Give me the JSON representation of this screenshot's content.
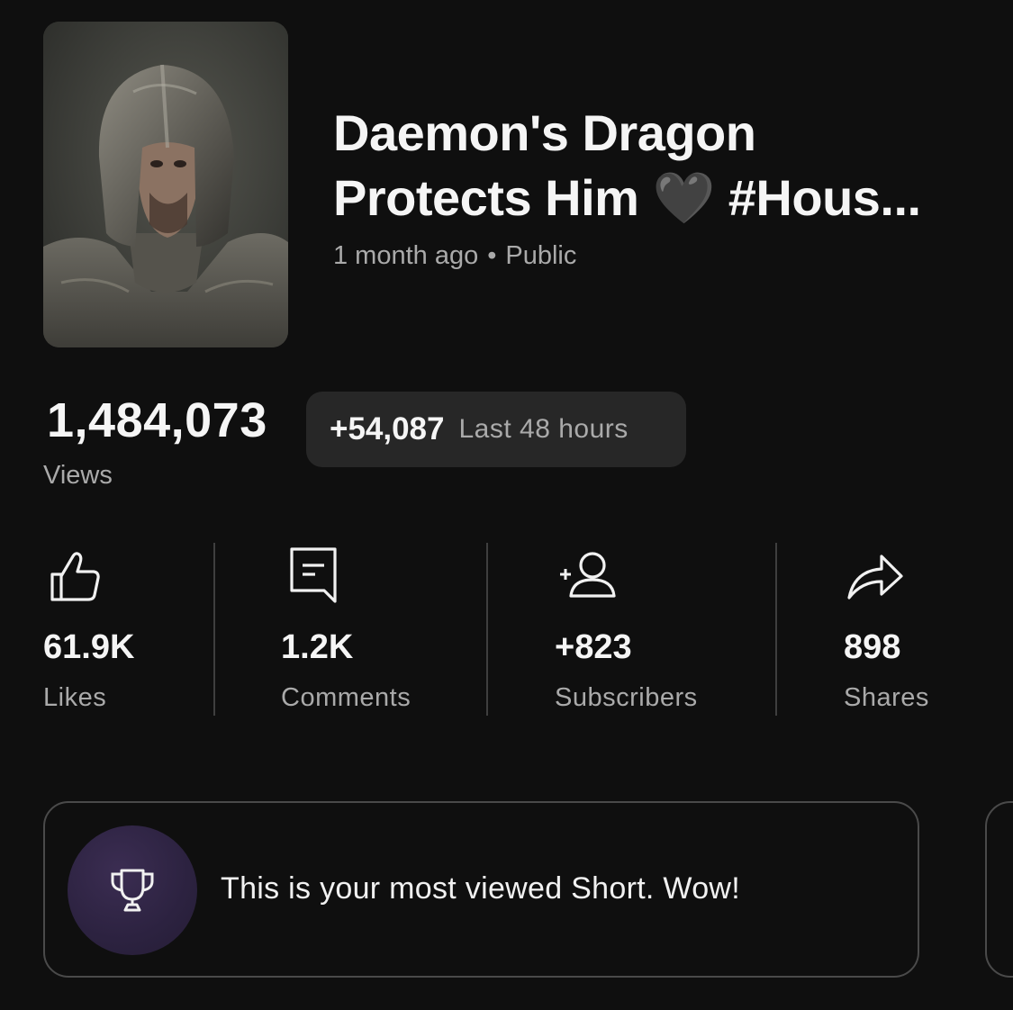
{
  "video": {
    "title": "Daemon's Dragon\nProtects Him 🖤 #Hous...",
    "age": "1 month ago",
    "separator": "•",
    "visibility": "Public",
    "thumbnail": "helmeted-knight-thumbnail"
  },
  "views": {
    "count": "1,484,073",
    "label": "Views",
    "delta": "+54,087",
    "delta_period": "Last 48 hours"
  },
  "stats": [
    {
      "icon": "thumbs-up-icon",
      "value": "61.9K",
      "label": "Likes"
    },
    {
      "icon": "comment-icon",
      "value": "1.2K",
      "label": "Comments"
    },
    {
      "icon": "add-person-icon",
      "value": "+823",
      "label": "Subscribers"
    },
    {
      "icon": "share-arrow-icon",
      "value": "898",
      "label": "Shares"
    }
  ],
  "insight_card": {
    "icon": "trophy-icon",
    "message": "This is your most viewed Short. Wow!"
  },
  "colors": {
    "background": "#0f0f0f",
    "pill": "#272727",
    "secondary_text": "#aaaaaa",
    "badge": "#2c2240"
  }
}
